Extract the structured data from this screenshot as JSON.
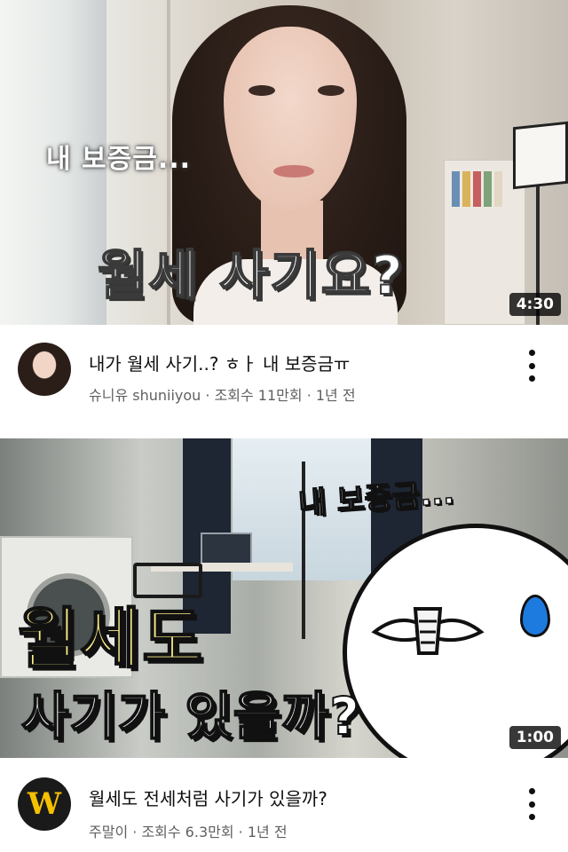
{
  "videos": [
    {
      "thumbnail_text_small": "내 보증금...",
      "thumbnail_text_big": "월세 사기요?",
      "duration": "4:30",
      "title": "내가 월세 사기..? ㅎㅏ 내 보증금ㅠ",
      "channel": "슈니유 shuniiyou",
      "views": "조회수 11만회",
      "age": "1년 전",
      "meta_separator": " · ",
      "menu_icon": "more-vert-icon"
    },
    {
      "thumbnail_text_small": "내 보증금...",
      "thumbnail_text_big_line1": "월세도",
      "thumbnail_text_big_line2": "사기가 있을까?",
      "duration": "1:00",
      "avatar_letter": "W",
      "title": "월세도 전세처럼 사기가 있을까?",
      "channel": "주말이",
      "views": "조회수 6.3만회",
      "age": "1년 전",
      "meta_separator": " · ",
      "menu_icon": "more-vert-icon"
    }
  ],
  "colors": {
    "subtitle_text": "#606060",
    "duration_badge": "#000000",
    "thumb2_highlight": "#fff08a",
    "thumb2_drop": "#1d7be0"
  }
}
